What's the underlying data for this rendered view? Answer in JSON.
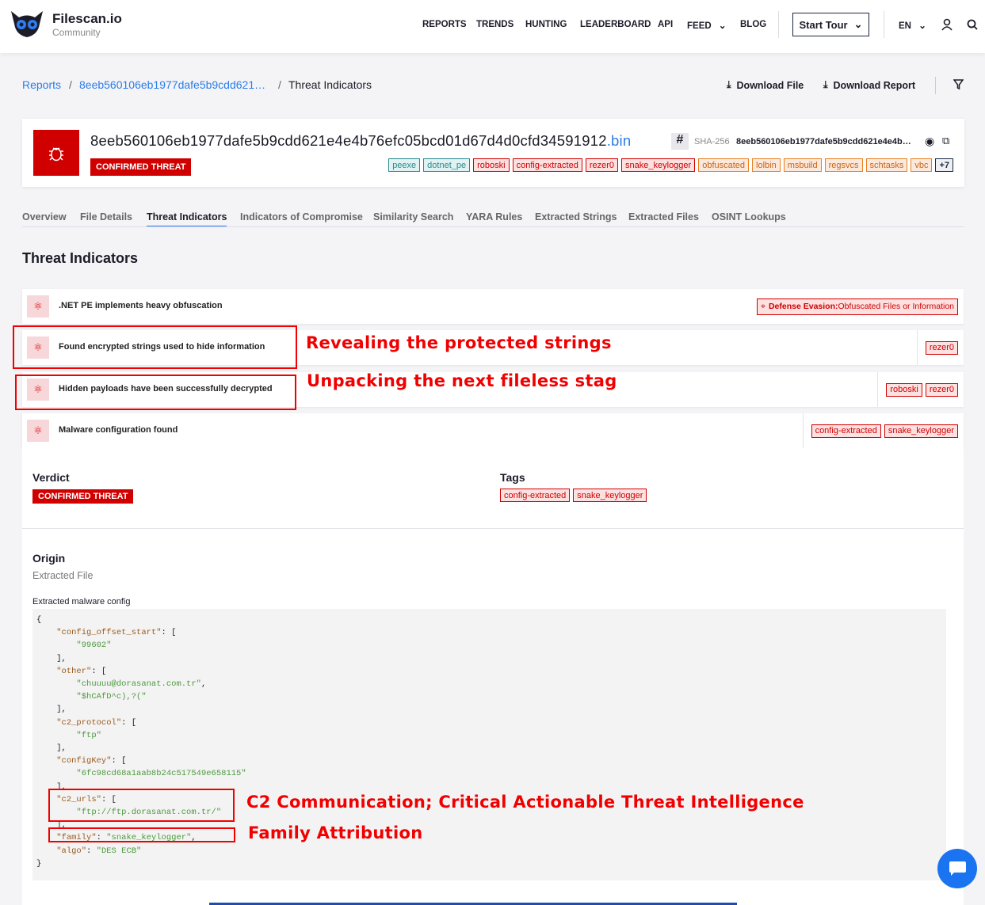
{
  "brand": {
    "name": "Filescan.io",
    "subtitle": "Community"
  },
  "nav": {
    "items": [
      "REPORTS",
      "TRENDS",
      "HUNTING",
      "LEADERBOARD",
      "API",
      "FEED",
      "BLOG"
    ],
    "tour": "Start Tour",
    "lang": "EN"
  },
  "breadcrumb": {
    "root": "Reports",
    "hash": "8eeb560106eb1977dafe5b9cdd621…",
    "current": "Threat Indicators"
  },
  "actions": {
    "download_file": "Download File",
    "download_report": "Download Report"
  },
  "file": {
    "hash": "8eeb560106eb1977dafe5b9cdd621e4e4b76efc05bcd01d67d4d0cfd34591912",
    "ext": ".bin",
    "verdict": "CONFIRMED THREAT",
    "sha_label": "SHA-256",
    "sha_value": "8eeb560106eb1977dafe5b9cdd621e4e4b…",
    "hash_symbol": "#",
    "tags": [
      {
        "t": "peexe",
        "c": "teal"
      },
      {
        "t": "dotnet_pe",
        "c": "teal"
      },
      {
        "t": "roboski",
        "c": "red"
      },
      {
        "t": "config-extracted",
        "c": "red"
      },
      {
        "t": "rezer0",
        "c": "red"
      },
      {
        "t": "snake_keylogger",
        "c": "red"
      },
      {
        "t": "obfuscated",
        "c": "org"
      },
      {
        "t": "lolbin",
        "c": "org"
      },
      {
        "t": "msbuild",
        "c": "org"
      },
      {
        "t": "regsvcs",
        "c": "org"
      },
      {
        "t": "schtasks",
        "c": "org"
      },
      {
        "t": "vbc",
        "c": "org"
      },
      {
        "t": "+7",
        "c": "dark"
      }
    ]
  },
  "tabs": [
    "Overview",
    "File Details",
    "Threat Indicators",
    "Indicators of Compromise",
    "Similarity Search",
    "YARA Rules",
    "Extracted Strings",
    "Extracted Files",
    "OSINT Lookups"
  ],
  "section_title": "Threat Indicators",
  "indicators": [
    {
      "text": ".NET PE implements heavy obfuscation",
      "mitre": "Defense Evasion:",
      "mitre_detail": " Obfuscated Files or Information",
      "tags": []
    },
    {
      "text": "Found encrypted strings used to hide information",
      "tags": [
        "rezer0"
      ]
    },
    {
      "text": "Hidden payloads have been successfully decrypted",
      "tags": [
        "roboski",
        "rezer0"
      ]
    },
    {
      "text": "Malware configuration found",
      "tags": [
        "config-extracted",
        "snake_keylogger"
      ]
    }
  ],
  "detail": {
    "verdict_label": "Verdict",
    "verdict": "CONFIRMED THREAT",
    "tags_label": "Tags",
    "tags": [
      "config-extracted",
      "snake_keylogger"
    ],
    "origin_label": "Origin",
    "origin": "Extracted File",
    "config_label": "Extracted malware config"
  },
  "code_lines": [
    "{",
    "    \"config_offset_start\": [",
    "        \"99602\"",
    "    ],",
    "    \"other\": [",
    "        \"chuuuu@dorasanat.com.tr\",",
    "        \"$hCAfD^c),?(\"",
    "    ],",
    "    \"c2_protocol\": [",
    "        \"ftp\"",
    "    ],",
    "    \"configKey\": [",
    "        \"6fc98cd68a1aab8b24c517549e658115\"",
    "    ],",
    "    \"c2_urls\": [",
    "        \"ftp://ftp.dorasanat.com.tr/\"",
    "    ],",
    "    \"family\": \"snake_keylogger\",",
    "    \"algo\": \"DES ECB\"",
    "}"
  ],
  "annotations": [
    "Revealing the protected strings",
    "Unpacking the next fileless stage",
    "C2 Communication; Critical Actionable Threat Intelligence",
    "Family Attribution"
  ]
}
